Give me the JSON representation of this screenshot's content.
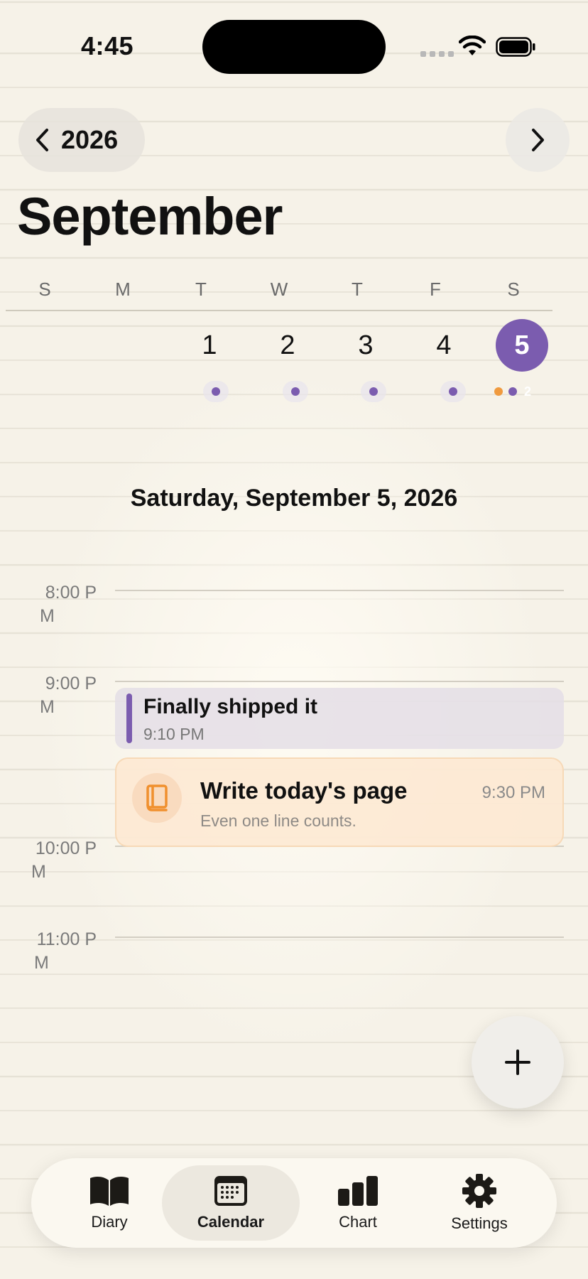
{
  "status": {
    "time": "4:45"
  },
  "header": {
    "year": "2026",
    "month": "September"
  },
  "week": {
    "weekdays": [
      "S",
      "M",
      "T",
      "W",
      "T",
      "F",
      "S"
    ],
    "days": [
      "1",
      "2",
      "3",
      "4",
      "5"
    ],
    "selected_day": "5",
    "selected_entry_count": "2"
  },
  "selected_date": "Saturday, September 5, 2026",
  "timeline": {
    "hours": [
      {
        "line1": "8:00 P",
        "line2": "M"
      },
      {
        "line1": "9:00 P",
        "line2": "M"
      },
      {
        "line1": "10:00 P",
        "line2": "M"
      },
      {
        "line1": "11:00 P",
        "line2": "M"
      }
    ],
    "diary_entry": {
      "title": "Finally shipped it",
      "time": "9:10 PM"
    },
    "reminder": {
      "title": "Write today's page",
      "subtitle": "Even one line counts.",
      "time": "9:30 PM"
    }
  },
  "tabs": [
    {
      "label": "Diary"
    },
    {
      "label": "Calendar"
    },
    {
      "label": "Chart"
    },
    {
      "label": "Settings"
    }
  ],
  "colors": {
    "accent": "#7b5caf",
    "reminder": "#f09a3e",
    "paper": "#f6f2e8"
  }
}
